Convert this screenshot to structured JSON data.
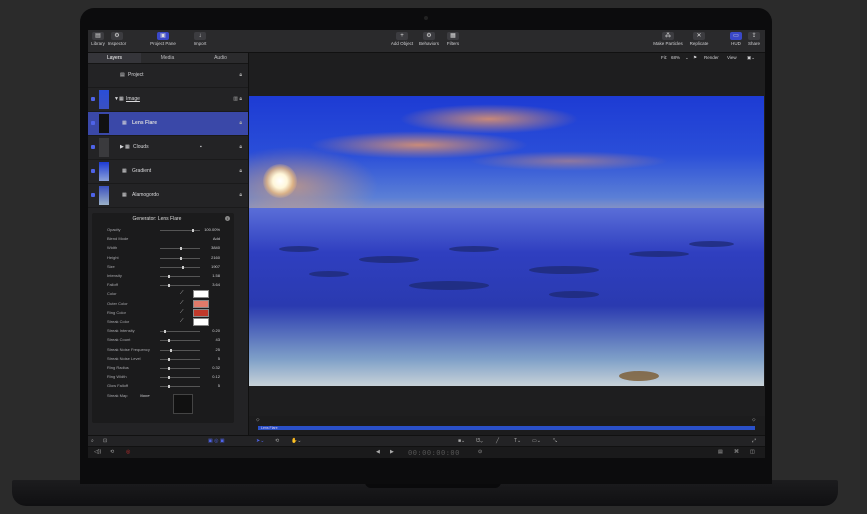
{
  "toolbar": {
    "library": "Library",
    "inspector": "Inspector",
    "project_pane": "Project Pane",
    "import": "Import",
    "add_object": "Add Object",
    "behaviors": "Behaviors",
    "filters": "Filters",
    "make_particles": "Make Particles",
    "replicate": "Replicate",
    "hud": "HUD",
    "share": "Share"
  },
  "tabs": [
    "Layers",
    "Media",
    "Audio"
  ],
  "layers": [
    {
      "name": "Project"
    },
    {
      "name": "Image"
    },
    {
      "name": "Lens Flare"
    },
    {
      "name": "Clouds"
    },
    {
      "name": "Gradient"
    },
    {
      "name": "Alamogordo"
    }
  ],
  "canvas_bar": {
    "fit_label": "Fit:",
    "fit_value": "68%",
    "render": "Render",
    "view": "View"
  },
  "inspector": {
    "title": "Generator: Lens Flare",
    "props": [
      {
        "label": "Opacity",
        "value": "100.00%"
      },
      {
        "label": "Blend Mode",
        "value": "Add"
      },
      {
        "label": "Width",
        "value": "3840"
      },
      {
        "label": "Height",
        "value": "2160"
      },
      {
        "label": "Size",
        "value": "1907"
      },
      {
        "label": "Intensity",
        "value": "1.58"
      },
      {
        "label": "Falloff",
        "value": "3.64"
      },
      {
        "label": "Color",
        "value": ""
      },
      {
        "label": "Outer Color",
        "value": ""
      },
      {
        "label": "Ring Color",
        "value": ""
      },
      {
        "label": "Streak Color",
        "value": ""
      },
      {
        "label": "Streak Intensity",
        "value": "0.20"
      },
      {
        "label": "Streak Count",
        "value": "43"
      },
      {
        "label": "Streak Noise Frequency",
        "value": "25"
      },
      {
        "label": "Streak Noise Level",
        "value": "5"
      },
      {
        "label": "Ring Radius",
        "value": "0.32"
      },
      {
        "label": "Ring Width",
        "value": "0.12"
      },
      {
        "label": "Glow Falloff",
        "value": "5"
      },
      {
        "label": "Streak Map",
        "value": "None"
      }
    ],
    "swatches": [
      "#ffffff",
      "#e07a6a",
      "#c0392b",
      "#ffffff"
    ]
  },
  "timeline": {
    "clip_label": "Lens Flare"
  },
  "transport": {
    "timecode": "00:00:00:00"
  }
}
